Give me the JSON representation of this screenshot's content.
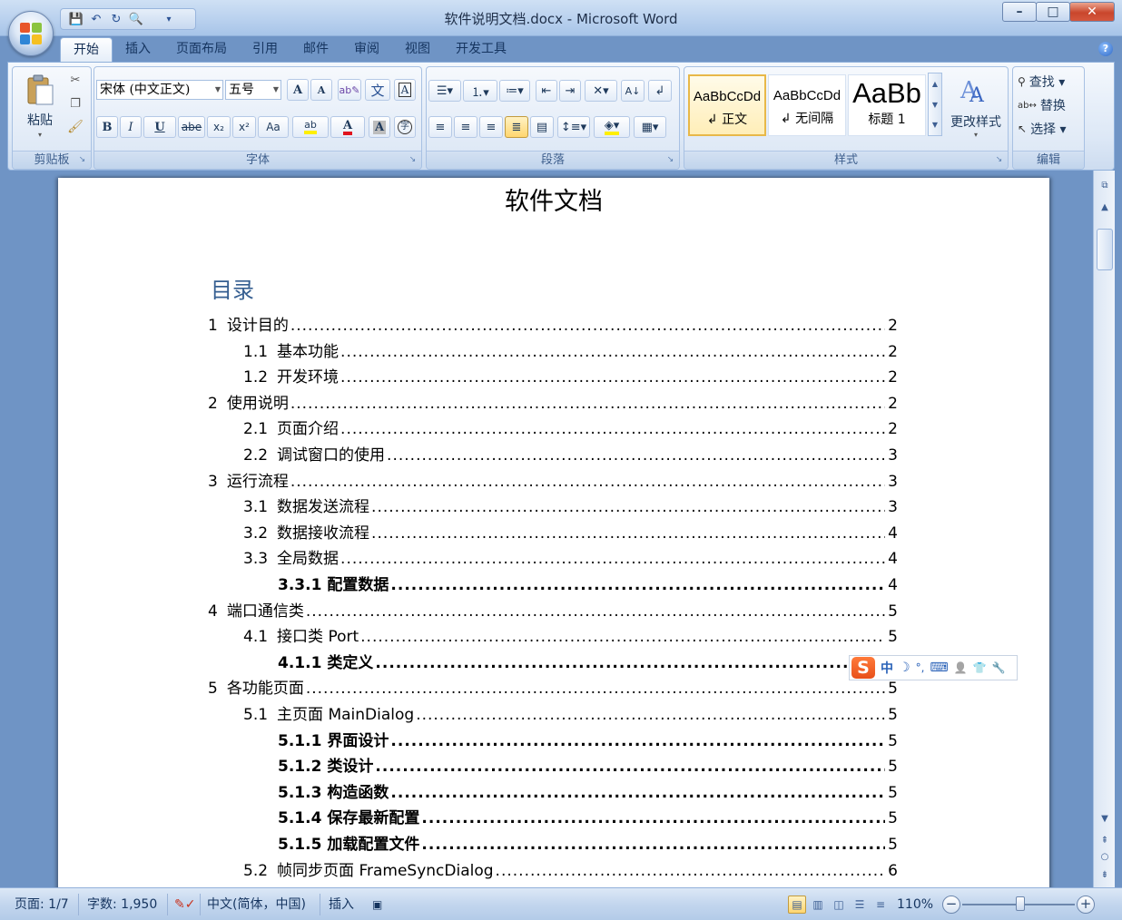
{
  "window": {
    "title": "软件说明文档.docx - Microsoft Word",
    "minimize": "–",
    "maximize": "□",
    "close": "✕"
  },
  "qat": {
    "save_icon": "💾",
    "undo_icon": "↶",
    "redo_icon": "↻",
    "preview_icon": "🔍",
    "customize_icon": "▾"
  },
  "tabs": [
    {
      "label": "开始",
      "active": true
    },
    {
      "label": "插入"
    },
    {
      "label": "页面布局"
    },
    {
      "label": "引用"
    },
    {
      "label": "邮件"
    },
    {
      "label": "审阅"
    },
    {
      "label": "视图"
    },
    {
      "label": "开发工具"
    }
  ],
  "ribbon": {
    "clipboard": {
      "label": "剪贴板",
      "paste": "粘贴"
    },
    "font": {
      "label": "字体",
      "font_name": "宋体 (中文正文)",
      "font_size": "五号",
      "grow": "A",
      "shrink": "A",
      "bold": "B",
      "italic": "I",
      "underline": "U",
      "strike": "abe",
      "subscript": "x₂",
      "superscript": "x²",
      "change_case": "Aa",
      "highlight": "ab",
      "font_color": "A",
      "char_shade": "A",
      "enclose": "字",
      "phonetic": "文",
      "border": "A"
    },
    "paragraph": {
      "label": "段落"
    },
    "styles": {
      "label": "样式",
      "items": [
        {
          "preview": "AaBbCcDd",
          "name": "↲ 正文"
        },
        {
          "preview": "AaBbCcDd",
          "name": "↲ 无间隔"
        },
        {
          "preview": "AaBb",
          "name": "标题 1"
        }
      ],
      "change_styles": "更改样式"
    },
    "editing": {
      "label": "编辑",
      "find": "查找 ▾",
      "replace": "替换",
      "select": "选择 ▾"
    }
  },
  "document": {
    "title": "软件文档",
    "toc_heading": "目录",
    "toc": [
      {
        "num": "1",
        "text": "设计目的",
        "page": "2",
        "level": 1
      },
      {
        "num": "1.1",
        "text": "基本功能",
        "page": "2",
        "level": 2
      },
      {
        "num": "1.2",
        "text": "开发环境",
        "page": "2",
        "level": 2
      },
      {
        "num": "2",
        "text": "使用说明",
        "page": "2",
        "level": 1
      },
      {
        "num": "2.1",
        "text": "页面介绍",
        "page": "2",
        "level": 2
      },
      {
        "num": "2.2",
        "text": "调试窗口的使用",
        "page": "3",
        "level": 2
      },
      {
        "num": "3",
        "text": "运行流程",
        "page": "3",
        "level": 1
      },
      {
        "num": "3.1",
        "text": "数据发送流程",
        "page": "3",
        "level": 2
      },
      {
        "num": "3.2",
        "text": "数据接收流程",
        "page": "4",
        "level": 2
      },
      {
        "num": "3.3",
        "text": "全局数据",
        "page": "4",
        "level": 2
      },
      {
        "num": "3.3.1",
        "text": "配置数据",
        "page": "4",
        "level": 3
      },
      {
        "num": "4",
        "text": "端口通信类",
        "page": "5",
        "level": 1
      },
      {
        "num": "4.1",
        "text": "接口类 Port",
        "page": "5",
        "level": 2
      },
      {
        "num": "4.1.1",
        "text": "类定义",
        "page": "5",
        "level": 3
      },
      {
        "num": "5",
        "text": "各功能页面",
        "page": "5",
        "level": 1
      },
      {
        "num": "5.1",
        "text": "主页面 MainDialog",
        "page": "5",
        "level": 2
      },
      {
        "num": "5.1.1",
        "text": "界面设计",
        "page": "5",
        "level": 3
      },
      {
        "num": "5.1.2",
        "text": "类设计",
        "page": "5",
        "level": 3
      },
      {
        "num": "5.1.3",
        "text": "构造函数",
        "page": "5",
        "level": 3
      },
      {
        "num": "5.1.4",
        "text": "保存最新配置",
        "page": "5",
        "level": 3
      },
      {
        "num": "5.1.5",
        "text": "加载配置文件",
        "page": "5",
        "level": 3
      },
      {
        "num": "5.2",
        "text": "帧同步页面 FrameSyncDialog",
        "page": "6",
        "level": 2
      }
    ]
  },
  "ime": {
    "logo": "S",
    "mode": "中",
    "moon_icon": "☽",
    "punct_icon": "°,",
    "keyboard_icon": "⌨",
    "user_icon": "👤",
    "skin_icon": "👕",
    "tool_icon": "🔧"
  },
  "statusbar": {
    "page": "页面: 1/7",
    "words": "字数: 1,950",
    "language": "中文(简体，中国)",
    "mode": "插入",
    "zoom": "110%",
    "zoom_value": 110
  }
}
